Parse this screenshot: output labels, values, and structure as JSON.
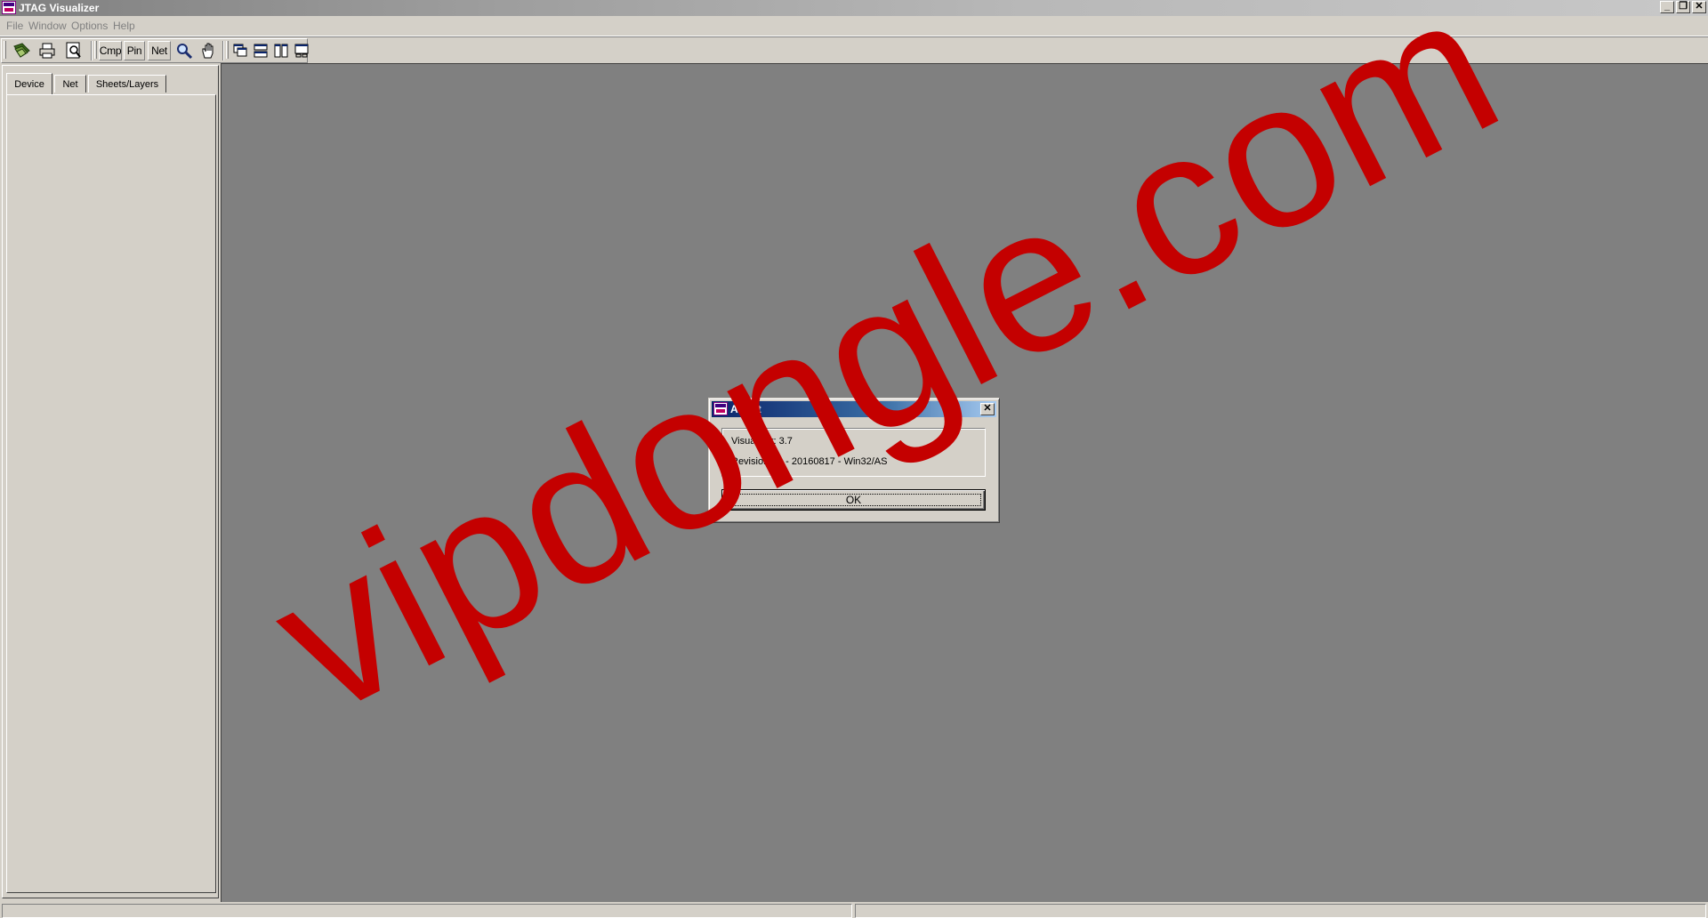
{
  "window": {
    "title": "JTAG Visualizer",
    "controls": [
      "minimize-icon",
      "restore-icon",
      "close-icon"
    ]
  },
  "menu": [
    "File",
    "Window",
    "Options",
    "Help"
  ],
  "toolbar": {
    "icons_left": [
      "open-icon",
      "print-icon",
      "print-preview-icon"
    ],
    "text_buttons": [
      "Cmp",
      "Pin",
      "Net"
    ],
    "tools": [
      "zoom-icon",
      "pan-hand-icon"
    ],
    "window_icons": [
      "cascade-icon",
      "tile-horizontal-icon",
      "tile-vertical-icon",
      "arrange-icon"
    ]
  },
  "tabs": [
    "Device",
    "Net",
    "Sheets/Layers"
  ],
  "dialog": {
    "title": "About",
    "version_line": "Visualizer: 3.7",
    "revision_line": "Revision - 1 - 20160817 - Win32/AS",
    "ok_label": "OK"
  },
  "watermark": "vipdongle.com",
  "colors": {
    "workspace": "#808080",
    "chrome": "#d4d0c8",
    "dialog_title": "#0a246a",
    "watermark": "#c40000"
  }
}
